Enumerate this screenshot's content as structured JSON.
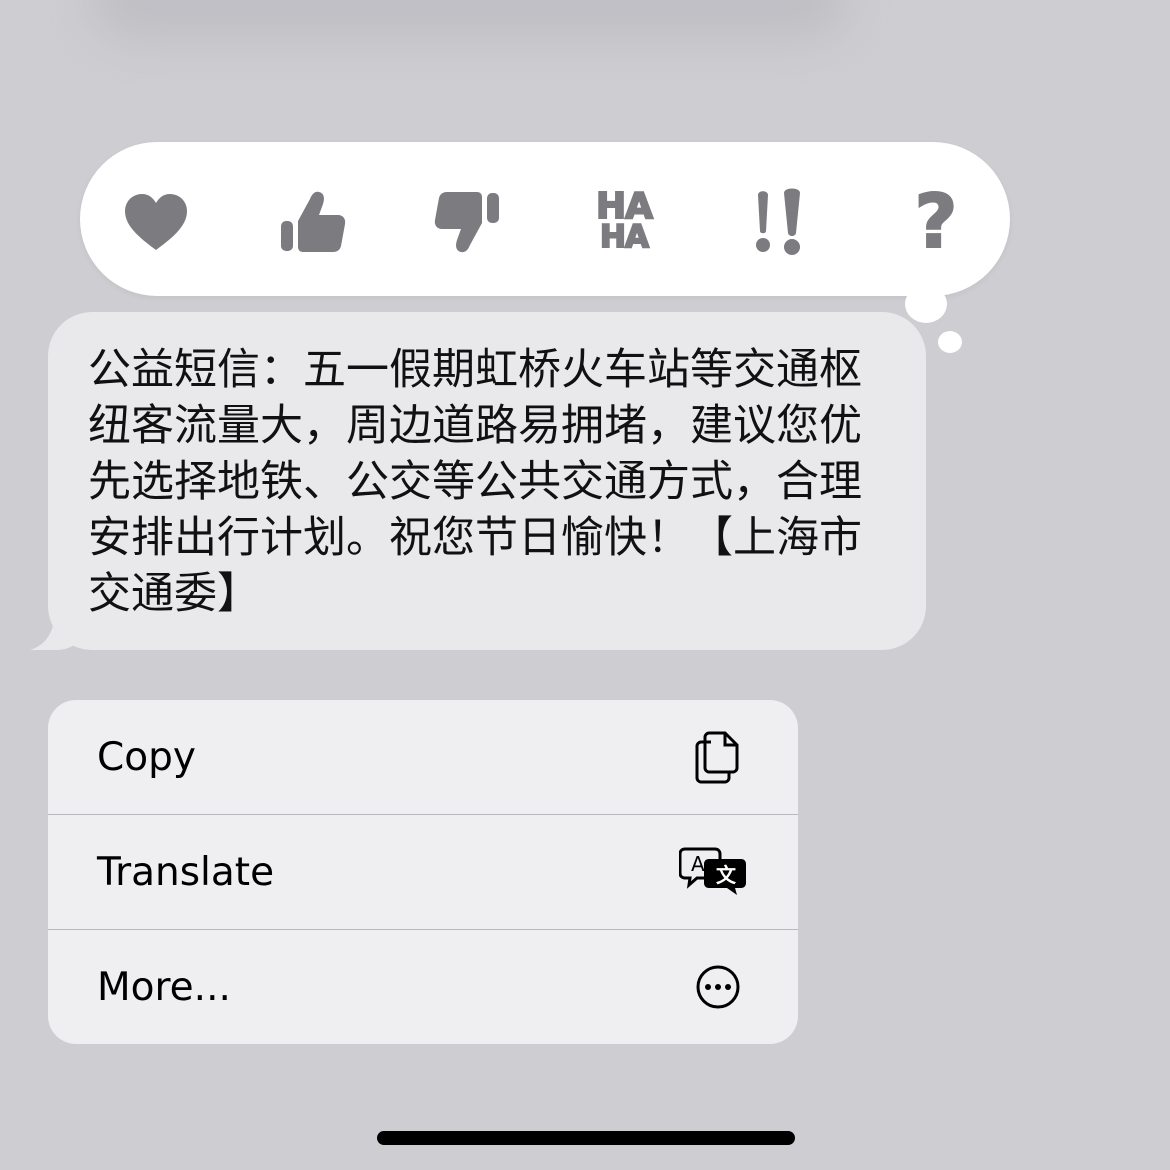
{
  "tapbacks": [
    {
      "name": "heart",
      "label": ""
    },
    {
      "name": "thumbs-up",
      "label": ""
    },
    {
      "name": "thumbs-down",
      "label": ""
    },
    {
      "name": "haha",
      "line1": "HA",
      "line2": "HA"
    },
    {
      "name": "emphasize",
      "label": "!!"
    },
    {
      "name": "question",
      "label": "?"
    }
  ],
  "message": {
    "text": "公益短信：五一假期虹桥火车站等交通枢纽客流量大，周边道路易拥堵，建议您优先选择地铁、公交等公共交通方式，合理安排出行计划。祝您节日愉快！【上海市交通委】"
  },
  "menu": {
    "items": [
      {
        "label": "Copy",
        "icon": "copy-icon"
      },
      {
        "label": "Translate",
        "icon": "translate-icon"
      },
      {
        "label": "More...",
        "icon": "more-icon"
      }
    ]
  },
  "colors": {
    "background": "#cdcdd2",
    "tapback_icon": "#7b7b80",
    "bubble": "#e9e9eb",
    "menu": "#efeff1"
  }
}
